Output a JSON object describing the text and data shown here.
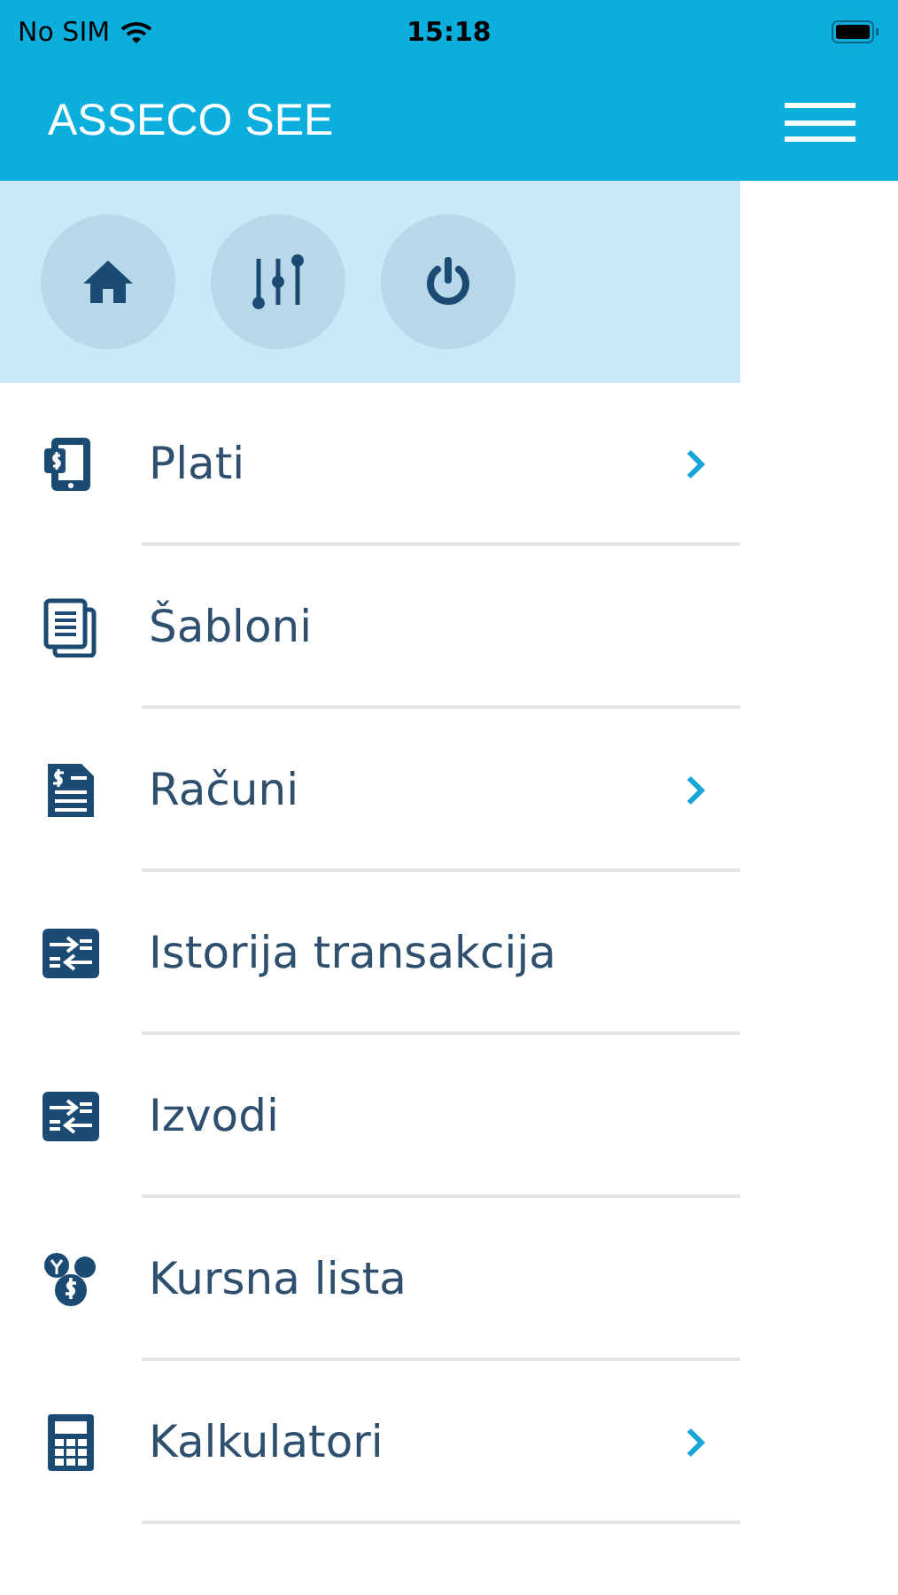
{
  "status_bar": {
    "carrier": "No SIM",
    "time": "15:18"
  },
  "header": {
    "title": "ASSECO SEE"
  },
  "menu": [
    {
      "label": "Plati",
      "has_submenu": true
    },
    {
      "label": "Šabloni",
      "has_submenu": false
    },
    {
      "label": "Računi",
      "has_submenu": true
    },
    {
      "label": "Istorija transakcija",
      "has_submenu": false
    },
    {
      "label": "Izvodi",
      "has_submenu": false
    },
    {
      "label": "Kursna lista",
      "has_submenu": false
    },
    {
      "label": "Kalkulatori",
      "has_submenu": true
    }
  ]
}
